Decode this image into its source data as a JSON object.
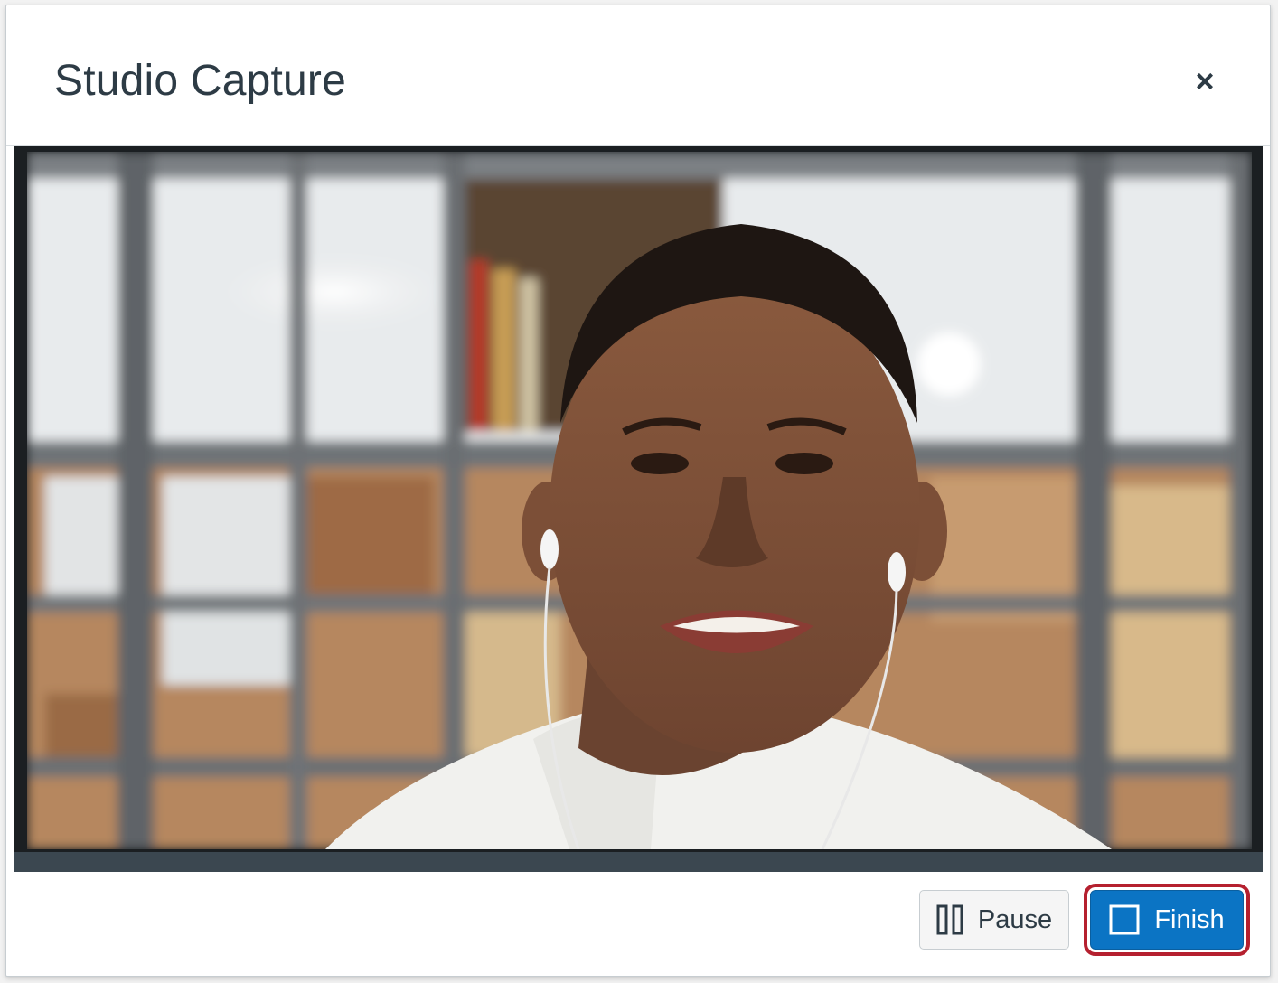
{
  "dialog": {
    "title": "Studio Capture",
    "close_label": "×"
  },
  "video": {
    "description_icon": "camera-feed"
  },
  "footer": {
    "pause_label": "Pause",
    "finish_label": "Finish"
  },
  "icons": {
    "close": "close-icon",
    "pause": "pause-icon",
    "stop": "stop-square-icon"
  },
  "colors": {
    "accent": "#0b74c4",
    "highlight": "#b5202f",
    "title_text": "#2d3b45"
  }
}
